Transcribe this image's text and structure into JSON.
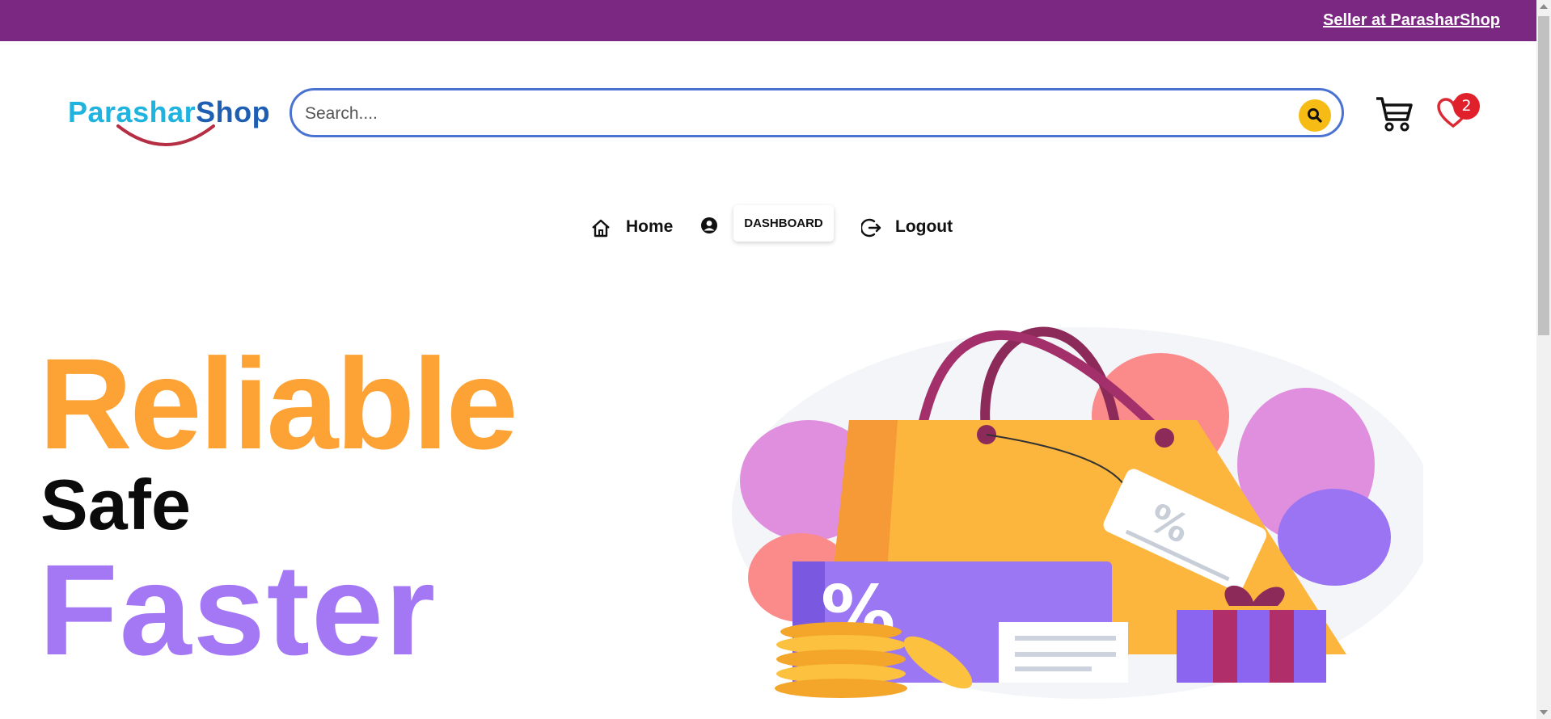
{
  "topbar": {
    "seller_link": "Seller at ParasharShop",
    "bg_color": "#7a2882"
  },
  "logo": {
    "part1": "Parashar",
    "part2": "Shop",
    "color1": "#1fb3df",
    "color2": "#1f5fb3"
  },
  "search": {
    "placeholder": "Search....",
    "value": "",
    "icon": "search-icon"
  },
  "header_icons": {
    "cart_icon": "cart-icon",
    "wishlist_icon": "heart-icon",
    "wishlist_count": "2"
  },
  "nav": {
    "home_label": "Home",
    "home_icon": "home-icon",
    "user_icon": "user-circle-icon",
    "dashboard_label": "DASHBOARD",
    "logout_label": "Logout",
    "logout_icon": "logout-icon"
  },
  "hero": {
    "line1": "Reliable",
    "line1_color": "#fda234",
    "line2": "Safe",
    "line2_color": "#0b0b0b",
    "line3": "Faster",
    "line3_color": "#a478f4",
    "illustration": "shopping-bag-illustration"
  }
}
